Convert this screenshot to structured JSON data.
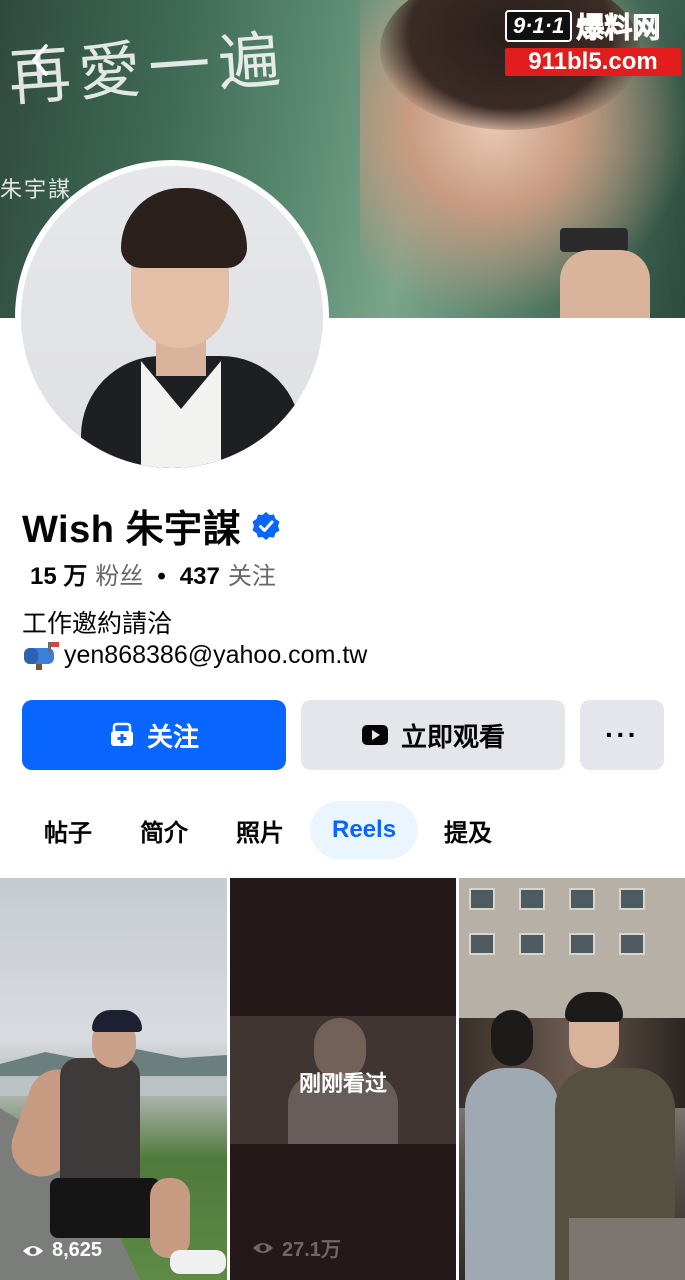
{
  "cover": {
    "script_text": "再愛一遍",
    "name_text": "朱宇謀"
  },
  "watermark": {
    "badge": "9·1·1",
    "cn": "爆料网",
    "url": "911bl5.com"
  },
  "profile": {
    "name": "Wish 朱宇謀",
    "verified": true,
    "followers_count": "15 万",
    "followers_label": "粉丝",
    "following_count": "437",
    "following_label": "关注",
    "bio_line1": "工作邀約請洽",
    "bio_email": "yen868386@yahoo.com.tw"
  },
  "actions": {
    "follow_label": "关注",
    "watch_label": "立即观看",
    "more_label": "···"
  },
  "tabs": [
    {
      "label": "帖子",
      "active": false
    },
    {
      "label": "简介",
      "active": false
    },
    {
      "label": "照片",
      "active": false
    },
    {
      "label": "Reels",
      "active": true
    },
    {
      "label": "提及",
      "active": false
    }
  ],
  "reels": [
    {
      "views": "8,625",
      "overlay": ""
    },
    {
      "views": "27.1万",
      "overlay": "刚刚看过"
    },
    {
      "views": "",
      "overlay": ""
    }
  ],
  "colors": {
    "accent": "#0866ff",
    "button_gray": "#e4e6eb",
    "active_tab_bg": "#ebf5ff",
    "muted_text": "#65676b"
  }
}
